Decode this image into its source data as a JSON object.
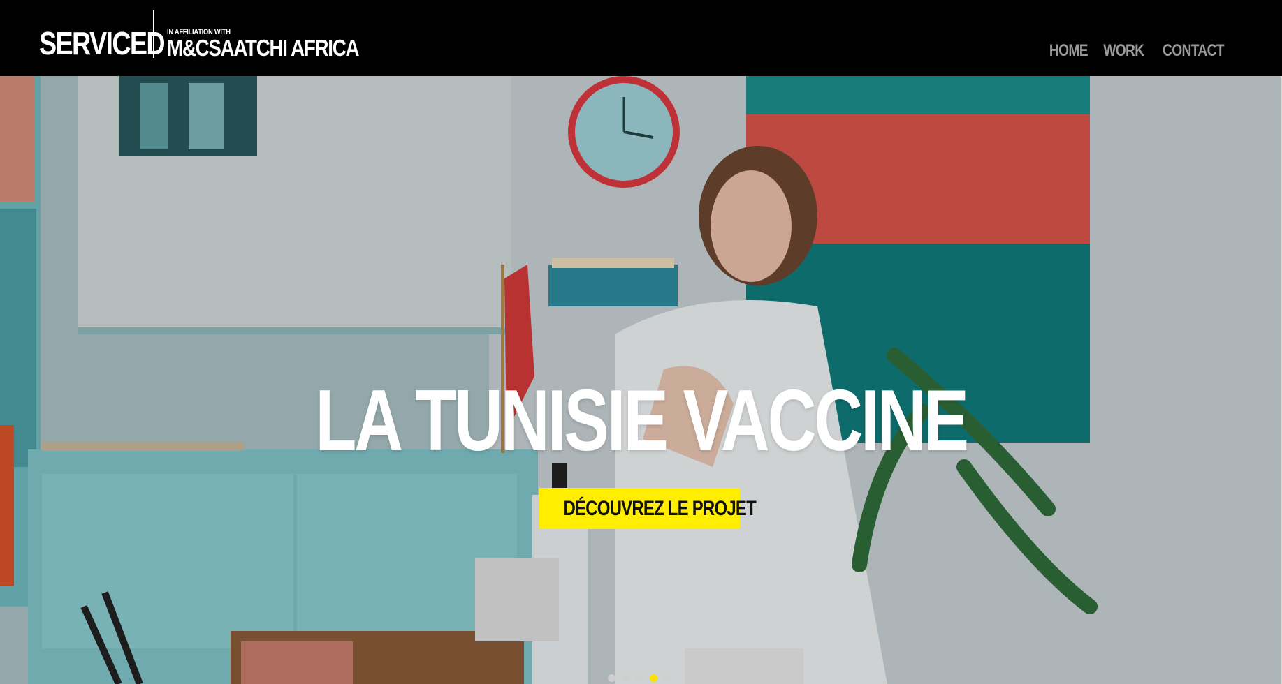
{
  "header": {
    "brand": "SERVICED",
    "affiliation_small": "IN AFFILIATION WITH",
    "affiliation_big": "M&CSAATCHI AFRICA"
  },
  "nav": {
    "items": [
      {
        "label": "HOME"
      },
      {
        "label": "WORK"
      },
      {
        "label": "CONTACT"
      }
    ]
  },
  "hero": {
    "title": "LA TUNISIE VACCINE",
    "cta_label": "DÉCOUVREZ LE PROJET",
    "slides_total": 5,
    "active_slide": 4
  },
  "colors": {
    "header_bg": "#000000",
    "nav_text": "#9a9a9a",
    "cta_bg": "#ffee00",
    "active_dot": "#ffe000"
  }
}
